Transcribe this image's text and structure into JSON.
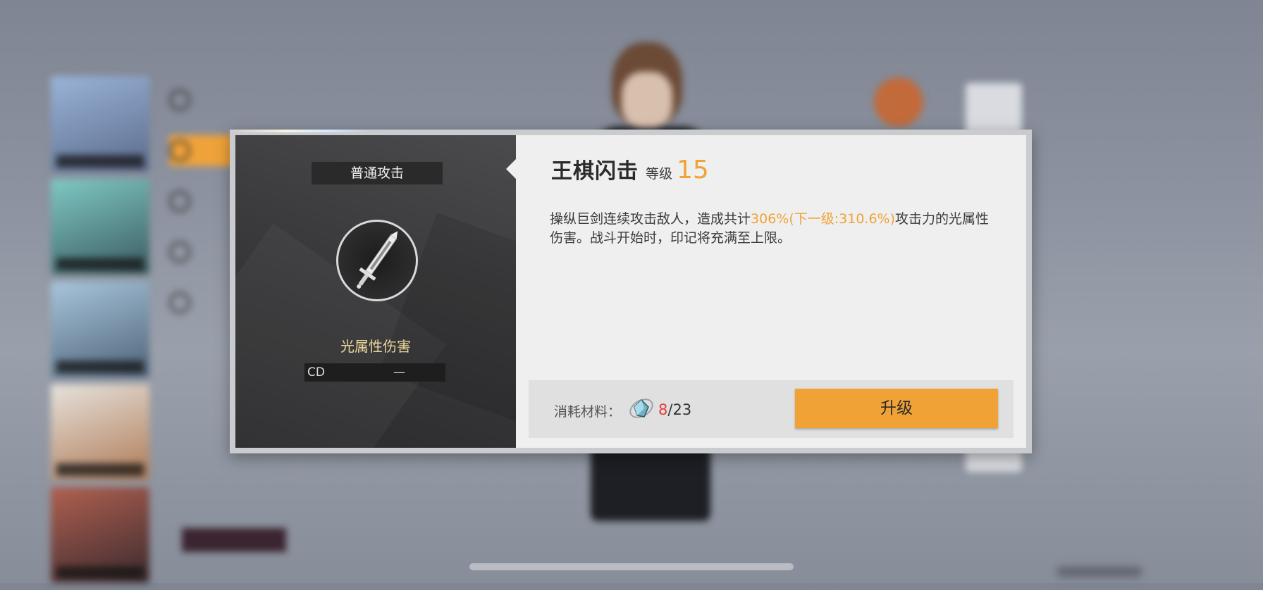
{
  "dialog": {
    "skill_type": "普通攻击",
    "skill_icon": "greatsword-icon",
    "damage_type": "光属性伤害",
    "cd_label": "CD",
    "cd_value": "—",
    "skill_name": "王棋闪击",
    "level_label": "等级",
    "level_value": "15",
    "description": {
      "part1": "操纵巨剑连续攻击敌人，造成共计",
      "highlight": "306%(下一级:310.6%)",
      "part2": "攻击力的光属性伤害。战斗开始时，印记将充满至上限。"
    },
    "materials_label": "消耗材料：",
    "material_icon": "crystal-material-icon",
    "materials_have": "8",
    "materials_sep": "/",
    "materials_need": "23",
    "upgrade_label": "升级"
  },
  "colors": {
    "accent": "#f0a236",
    "damage_text": "#e8d79a",
    "insufficient": "#e23c3c"
  }
}
